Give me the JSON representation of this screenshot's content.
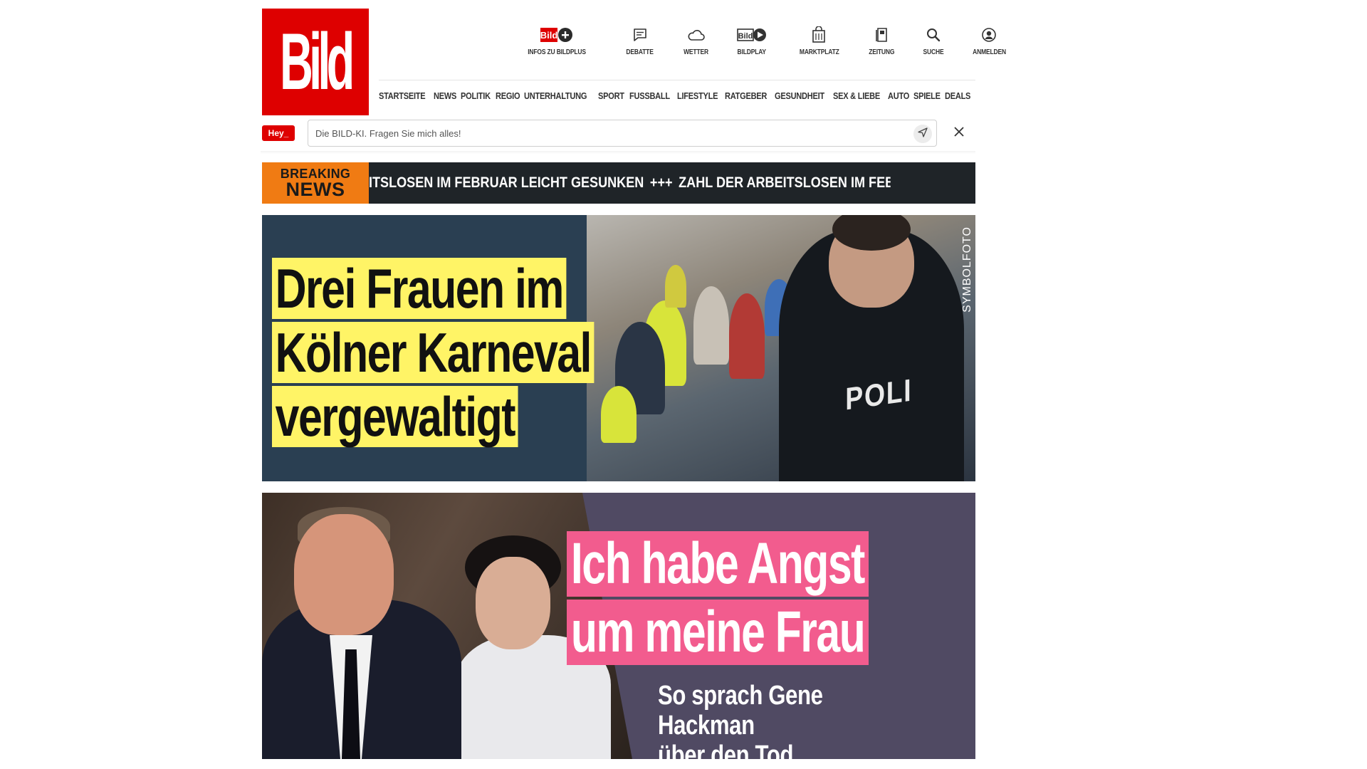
{
  "logo": {
    "text": "Bild",
    "color": "#de0000"
  },
  "topbar": {
    "bildplus": {
      "label": "INFOS ZU BILDPLUS",
      "icon": "bildplus-icon"
    },
    "items": [
      {
        "label": "DEBATTE",
        "icon": "chat-bubble-icon"
      },
      {
        "label": "WETTER",
        "icon": "cloud-icon"
      },
      {
        "label": "BILDPLAY",
        "icon": "bildplay-icon"
      },
      {
        "label": "MARKTPLATZ",
        "icon": "shopping-bag-icon"
      },
      {
        "label": "ZEITUNG",
        "icon": "newspaper-icon"
      },
      {
        "label": "SUCHE",
        "icon": "search-icon"
      },
      {
        "label": "ANMELDEN",
        "icon": "user-icon"
      }
    ]
  },
  "nav": {
    "items": [
      "STARTSEITE",
      "NEWS",
      "POLITIK",
      "REGIO",
      "UNTERHALTUNG",
      "SPORT",
      "FUSSBALL",
      "LIFESTYLE",
      "RATGEBER",
      "GESUNDHEIT",
      "SEX & LIEBE",
      "AUTO",
      "SPIELE",
      "DEALS"
    ]
  },
  "assistant": {
    "badge": "Hey_",
    "placeholder": "Die BILD-KI. Fragen Sie mich alles!",
    "send_icon": "send-icon",
    "close_icon": "close-icon"
  },
  "breaking": {
    "label_line1": "BREAKING",
    "label_line2": "NEWS",
    "ticker": [
      "ITSLOSEN IM FEBRUAR LEICHT GESUNKEN",
      "+++",
      "ZAHL DER ARBEITSLOSEN IM FEBRUAR LEICHT GESUNKEN",
      "++"
    ],
    "label_color": "#f07b13"
  },
  "teaser1": {
    "headline": [
      "Drei Frauen im",
      "Kölner Karneval",
      "vergewaltigt"
    ],
    "photo_label": "SYMBOLFOTO",
    "vest_text": "POLI",
    "highlight_color": "#fff466",
    "background": "#2a3f52"
  },
  "teaser2": {
    "headline": [
      "Ich habe Angst",
      "um meine Frau"
    ],
    "subline": [
      "So sprach Gene Hackman",
      "über den Tod"
    ],
    "highlight_color": "#f25c8e",
    "background": "#504a63"
  }
}
